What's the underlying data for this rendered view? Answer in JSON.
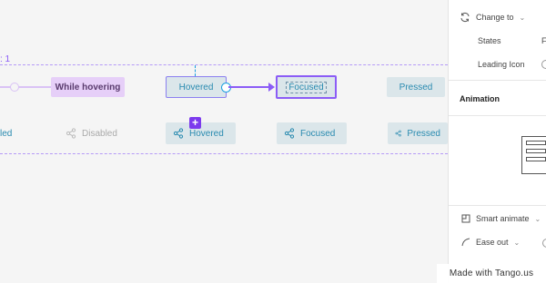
{
  "canvas": {
    "frame_label": ": 1",
    "row1": {
      "while_hovering": "While hovering",
      "hovered": "Hovered",
      "focused": "Focused",
      "pressed": "Pressed"
    },
    "row2": {
      "partial_led": "led",
      "disabled": "Disabled",
      "hovered": "Hovered",
      "focused": "Focused",
      "pressed": "Pressed"
    },
    "plus_badge": "+",
    "icons": {
      "share": "share-icon",
      "plus": "plus-icon",
      "node": "connection-node-icon"
    }
  },
  "panel": {
    "change_to": "Change to",
    "states_label": "States",
    "states_value": "F",
    "leading_icon_label": "Leading Icon",
    "animation_title": "Animation",
    "smart_animate": "Smart animate",
    "ease_out": "Ease out",
    "icons": {
      "refresh": "refresh-icon",
      "smart-animate": "smart-animate-icon",
      "ease": "ease-curve-icon",
      "chevron": "chevron-down-icon"
    }
  },
  "watermark": "Made with Tango.us",
  "colors": {
    "accent": "#8b5cf6",
    "chip_bg": "#dbe6ea",
    "chip_text": "#2a8bb0",
    "hover_chip_bg": "#e6cff8"
  }
}
